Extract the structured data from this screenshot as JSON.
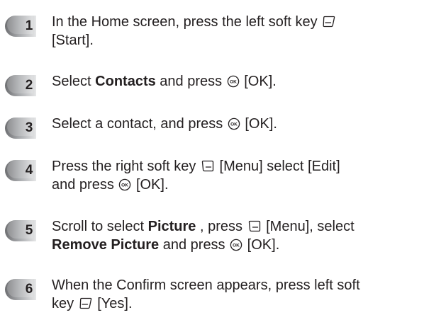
{
  "steps": [
    {
      "number": "1",
      "lines": [
        [
          "In the Home screen, press the left soft key ",
          {
            "icon": "left-soft-key-icon"
          }
        ],
        [
          {
            "text": "[Start]."
          }
        ]
      ]
    },
    {
      "number": "2",
      "lines": [
        [
          "Select ",
          {
            "bold": "Contacts"
          },
          " and press ",
          {
            "icon": "ok-key-icon"
          },
          " [OK]."
        ]
      ]
    },
    {
      "number": "3",
      "lines": [
        [
          "Select a contact, and press ",
          {
            "icon": "ok-key-icon"
          },
          " [OK]."
        ]
      ]
    },
    {
      "number": "4",
      "lines": [
        [
          "Press the right soft key ",
          {
            "icon": "right-soft-key-icon"
          },
          " [Menu] select [Edit]"
        ],
        [
          "and press ",
          {
            "icon": "ok-key-icon"
          },
          " [OK]."
        ]
      ]
    },
    {
      "number": "5",
      "lines": [
        [
          "Scroll to select ",
          {
            "bold": "Picture"
          },
          " , press ",
          {
            "icon": "right-soft-key-icon"
          },
          " [Menu], select"
        ],
        [
          {
            "bold": "Remove Picture"
          },
          " and press ",
          {
            "icon": "ok-key-icon"
          },
          " [OK]."
        ]
      ]
    },
    {
      "number": "6",
      "lines": [
        [
          "When the Confirm screen appears, press left soft"
        ],
        [
          "key ",
          {
            "icon": "left-soft-key-icon"
          },
          " [Yes]."
        ]
      ]
    }
  ],
  "colors": {
    "text": "#231f20",
    "badge_dark": "#6d6e71",
    "badge_light": "#e6e7e8"
  }
}
